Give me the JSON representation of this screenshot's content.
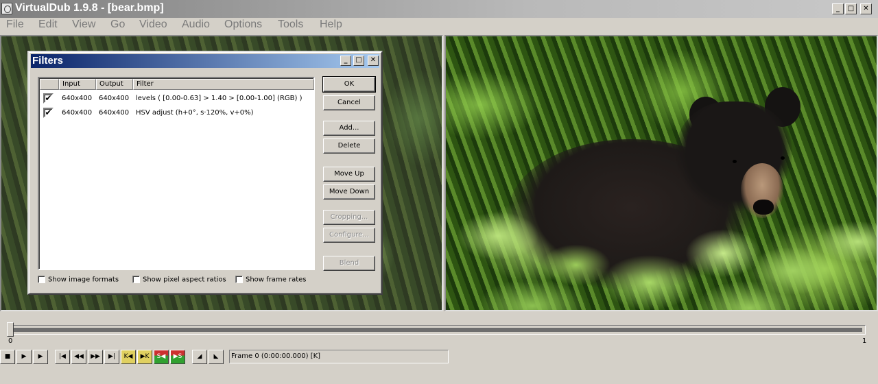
{
  "app": {
    "title": "VirtualDub 1.9.8 - [bear.bmp]",
    "window_buttons": [
      "_",
      "□",
      "✕"
    ]
  },
  "menu": [
    "File",
    "Edit",
    "View",
    "Go",
    "Video",
    "Audio",
    "Options",
    "Tools",
    "Help"
  ],
  "dialog": {
    "title": "Filters",
    "window_buttons": [
      "_",
      "□",
      "✕"
    ],
    "columns": [
      "Input",
      "Output",
      "Filter"
    ],
    "filters": [
      {
        "checked": true,
        "input": "640x400",
        "output": "640x400",
        "filter": "levels ( [0.00-0.63] > 1.40 > [0.00-1.00] (RGB) )"
      },
      {
        "checked": true,
        "input": "640x400",
        "output": "640x400",
        "filter": "HSV adjust (h+0°, s·120%, v+0%)"
      }
    ],
    "buttons": {
      "ok": "OK",
      "cancel": "Cancel",
      "add": "Add...",
      "delete": "Delete",
      "move_up": "Move Up",
      "move_down": "Move Down",
      "cropping": "Cropping...",
      "configure": "Configure...",
      "blend": "Blend"
    },
    "options": [
      "Show image formats",
      "Show pixel aspect ratios",
      "Show frame rates"
    ]
  },
  "timeline": {
    "start_label": "0",
    "end_label": "1",
    "position": 0
  },
  "toolbar": {
    "icons": [
      "stop-icon",
      "play-input-icon",
      "play-output-icon",
      "go-start-icon",
      "prev-frame-icon",
      "next-frame-icon",
      "go-end-icon",
      "prev-key-icon",
      "next-key-icon",
      "prev-scene-icon",
      "next-scene-icon",
      "mark-in-icon",
      "mark-out-icon"
    ],
    "glyphs": [
      "■",
      "▶",
      "▶",
      "|◀",
      "◀◀",
      "▶▶",
      "▶|",
      "K◀",
      "▶K",
      "S◀",
      "▶S",
      "◢",
      "◣"
    ]
  },
  "status": "Frame 0 (0:00:00.000) [K]"
}
